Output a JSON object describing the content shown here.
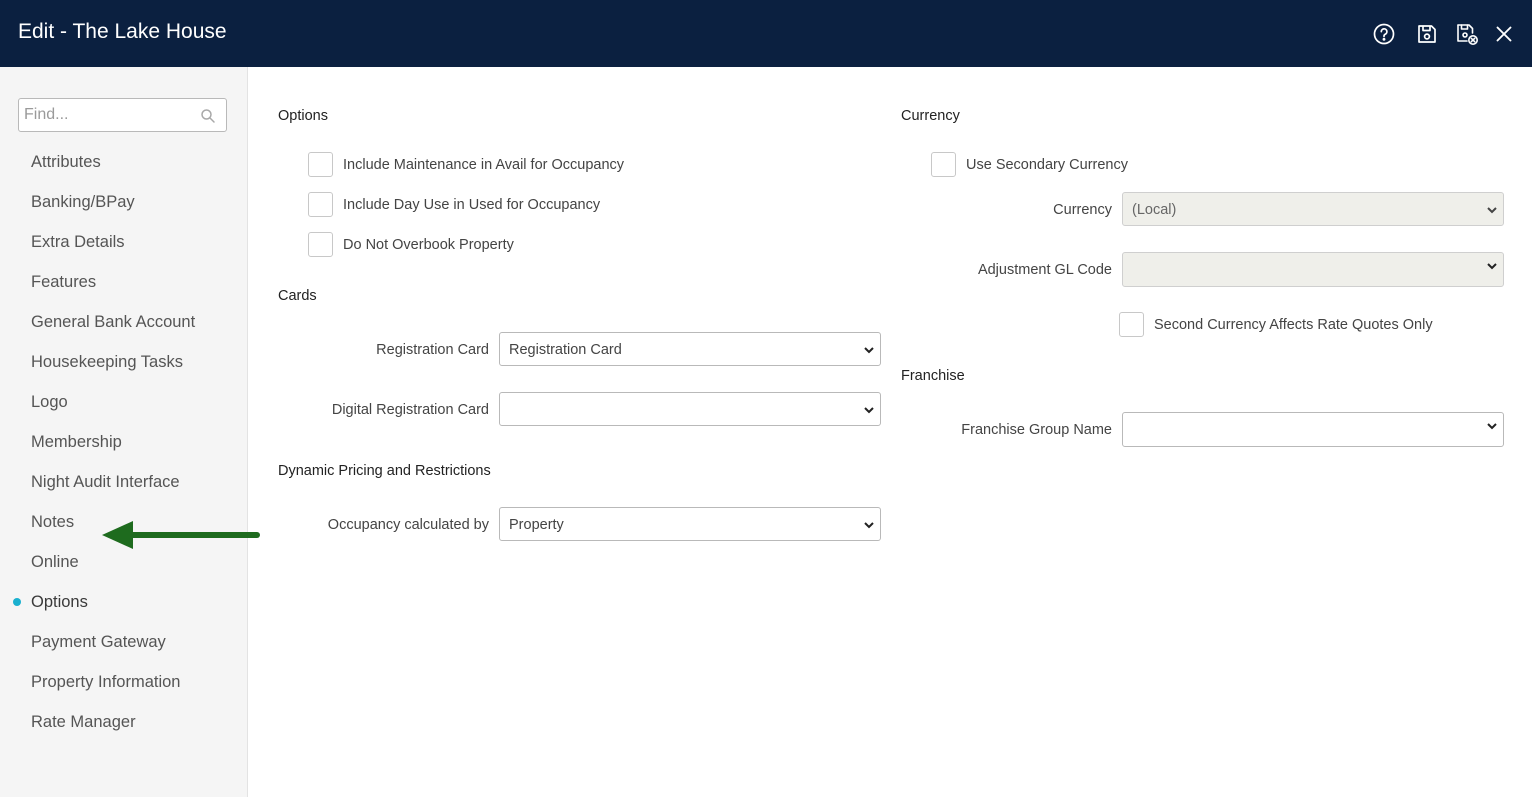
{
  "header": {
    "title": "Edit - The Lake House",
    "icons": [
      "help-icon",
      "save-icon",
      "save-close-icon",
      "close-icon"
    ]
  },
  "sidebar": {
    "search_placeholder": "Find...",
    "active_item": "Options",
    "items": [
      {
        "label": "Attributes"
      },
      {
        "label": "Banking/BPay"
      },
      {
        "label": "Extra Details"
      },
      {
        "label": "Features"
      },
      {
        "label": "General Bank Account"
      },
      {
        "label": "Housekeeping Tasks"
      },
      {
        "label": "Logo"
      },
      {
        "label": "Membership"
      },
      {
        "label": "Night Audit Interface"
      },
      {
        "label": "Notes"
      },
      {
        "label": "Online"
      },
      {
        "label": "Options"
      },
      {
        "label": "Payment Gateway"
      },
      {
        "label": "Property Information"
      },
      {
        "label": "Rate Manager"
      }
    ]
  },
  "options": {
    "title": "Options",
    "checkboxes": [
      {
        "label": "Include Maintenance in Avail for Occupancy",
        "checked": false
      },
      {
        "label": "Include Day Use in Used for Occupancy",
        "checked": false
      },
      {
        "label": "Do Not Overbook Property",
        "checked": false
      }
    ]
  },
  "cards": {
    "title": "Cards",
    "registration_card": {
      "label": "Registration Card",
      "value": "Registration Card"
    },
    "digital_registration_card": {
      "label": "Digital Registration Card",
      "value": ""
    }
  },
  "dynamic_pricing": {
    "title": "Dynamic Pricing and Restrictions",
    "occupancy": {
      "label": "Occupancy calculated by",
      "value": "Property"
    }
  },
  "currency": {
    "title": "Currency",
    "use_secondary": {
      "label": "Use Secondary Currency",
      "checked": false
    },
    "currency": {
      "label": "Currency",
      "value": "(Local)"
    },
    "adjustment_gl": {
      "label": "Adjustment GL Code",
      "value": ""
    },
    "second_currency_rate_quotes": {
      "label": "Second Currency Affects Rate Quotes Only",
      "checked": false
    }
  },
  "franchise": {
    "title": "Franchise",
    "group_name": {
      "label": "Franchise Group Name",
      "value": ""
    }
  },
  "colors": {
    "header_bg": "#0b2040",
    "active_dot": "#1ab0cf",
    "arrow": "#1e6b1e"
  }
}
